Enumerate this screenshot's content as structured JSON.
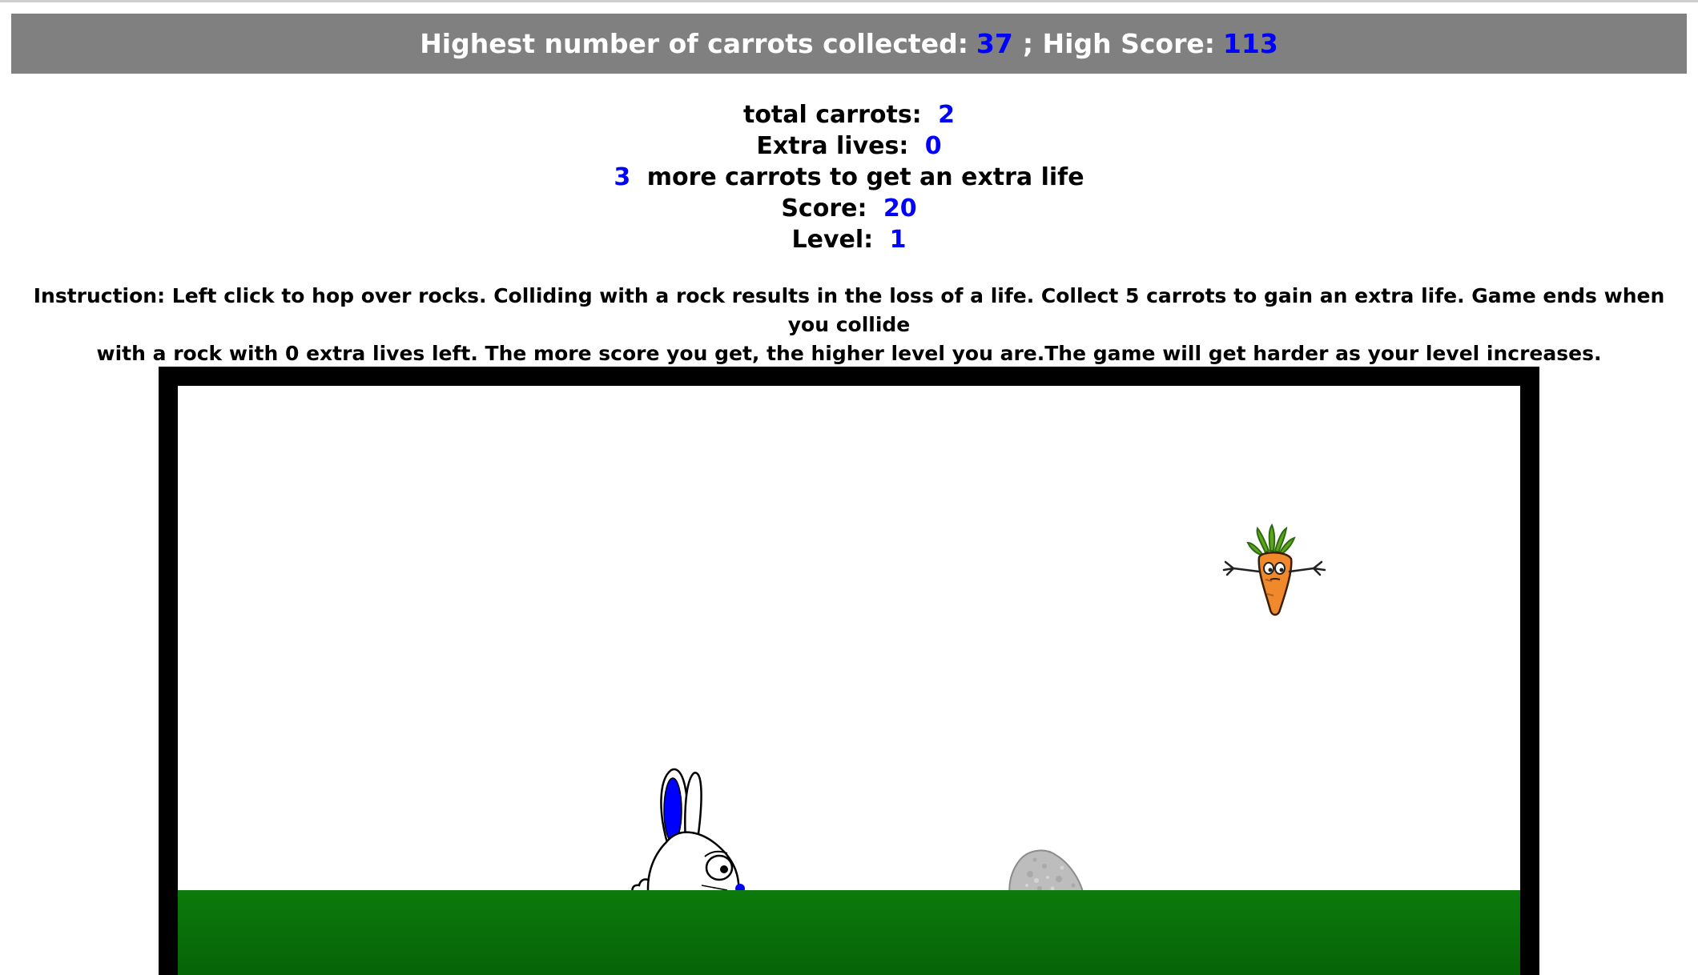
{
  "banner": {
    "carrots_label": "Highest number of carrots collected: ",
    "carrots_value": "37",
    "separator": " ; High Score: ",
    "score_value": "113"
  },
  "stats": {
    "total_carrots_label": "total carrots: ",
    "total_carrots_value": "2",
    "extra_lives_label": "Extra lives: ",
    "extra_lives_value": "0",
    "carrots_needed_value": "3",
    "carrots_needed_label": " more carrots to get an extra life",
    "score_label": "Score: ",
    "score_value": "20",
    "level_label": "Level: ",
    "level_value": "1"
  },
  "instruction": {
    "line1": "Instruction: Left click to hop over rocks. Colliding with a rock results in the loss of a life. Collect 5 carrots to gain an extra life. Game ends when you collide",
    "line2": "with a rock with 0 extra lives left. The more score you get, the higher level you are.The game will get harder as your level increases."
  },
  "colors": {
    "banner_bg": "#808080",
    "value_text": "#0000ff",
    "ground": "#0c7a0c",
    "frame": "#000000"
  },
  "sprites": {
    "player": "bunny-icon",
    "collectible": "carrot-icon",
    "obstacle": "rock-icon"
  }
}
